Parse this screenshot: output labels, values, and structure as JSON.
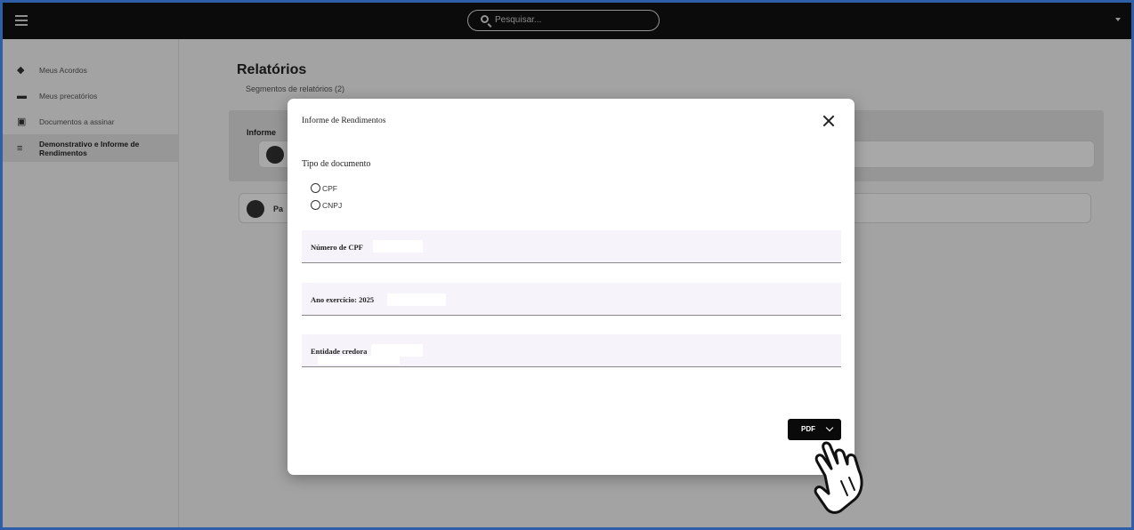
{
  "search": {
    "placeholder": "Pesquisar..."
  },
  "sidebar": {
    "items": [
      {
        "label": "Meus Acordos",
        "icon": "handshake-icon"
      },
      {
        "label": "Meus precatórios",
        "icon": "folder-icon"
      },
      {
        "label": "Documentos a assinar",
        "icon": "documents-icon"
      },
      {
        "label": "Demonstrativo e Informe de Rendimentos",
        "icon": "list-icon",
        "active": true
      }
    ]
  },
  "main": {
    "title": "Relatórios",
    "subtitle": "Segmentos de relatórios (2)",
    "segment_title": "Informe",
    "second_card_label": "Pa"
  },
  "dialog": {
    "title": "Informe de Rendimentos",
    "doc_type_label": "Tipo de documento",
    "radio_options": [
      "CPF",
      "CNPJ"
    ],
    "fields": [
      {
        "label": "Número de CPF"
      },
      {
        "label": "Ano exercício: 2025"
      },
      {
        "label": "Entidade credora"
      }
    ],
    "pdf_button_label": "PDF"
  },
  "colors": {
    "topbar": "#121212",
    "frame_border": "#2f5fa8",
    "field_background": "#f7f3fb",
    "button": "#0a0a0a"
  }
}
